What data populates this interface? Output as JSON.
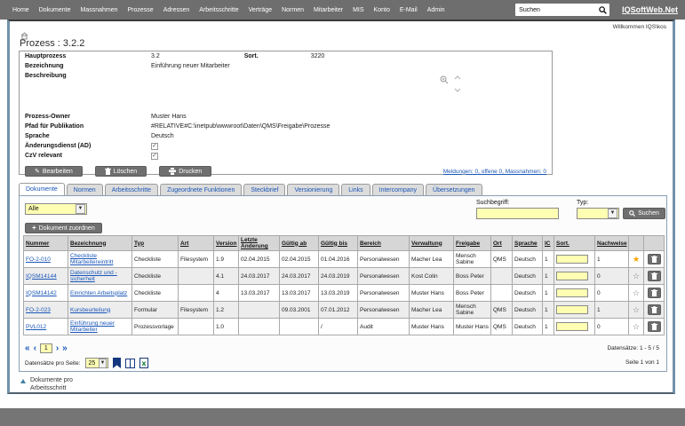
{
  "nav": {
    "items": [
      "Home",
      "Dokumente",
      "Massnahmen",
      "Prozesse",
      "Adressen",
      "Arbeitsschritte",
      "Verträge",
      "Normen",
      "Mitarbeiter",
      "MIS",
      "Konto",
      "E-Mail",
      "Admin"
    ],
    "search_value": "Suchen",
    "brand": "IQSoftWeb.Net"
  },
  "welcome": "Willkommen IQS\\kos",
  "page_title": "Prozess : 3.2.2",
  "form": {
    "hauptprozess_label": "Hauptprozess",
    "hauptprozess_value": "3.2",
    "sort_label": "Sort.",
    "sort_value": "3220",
    "bezeichnung_label": "Bezeichnung",
    "bezeichnung_value": "Einführung neuer Mitarbeiter",
    "beschreibung_label": "Beschreibung",
    "beschreibung_value": "",
    "owner_label": "Prozess-Owner",
    "owner_value": "Muster Hans",
    "pfad_label": "Pfad für Publikation",
    "pfad_value": "#RELATIVE#C:\\inetpub\\wwwroot\\Daten\\QMS\\Freigabe\\Prozesse",
    "sprache_label": "Sprache",
    "sprache_value": "Deutsch",
    "ad_label": "Änderungsdienst (AD)",
    "ad_checked": "✓",
    "czv_label": "CzV relevant",
    "czv_checked": "✓"
  },
  "actions": {
    "edit": "Bearbeiten",
    "delete": "Löschen",
    "print": "Drucken",
    "meldungen_link": "Meldungen: 0, offene 0, Massnahmen: 0"
  },
  "tabs": {
    "active_index": 0,
    "items": [
      "Dokumente",
      "Normen",
      "Arbeitsschritte",
      "Zugeordnete Funktionen",
      "Steckbrief",
      "Versionierung",
      "Links",
      "Intercompany",
      "Übersetzungen"
    ]
  },
  "filter": {
    "alle_value": "Alle",
    "suchbegriff_label": "Suchbegriff:",
    "typ_label": "Typ:",
    "typ_value": "",
    "suchen_button": "Suchen",
    "plus": "+",
    "add_button": "Dokument zuordnen"
  },
  "table": {
    "headers": [
      "Nummer",
      "Bezeichnung",
      "Typ",
      "Art",
      "Version",
      "Letzte Änderung",
      "Gültig ab",
      "Gültig bis",
      "Bereich",
      "Verwaltung",
      "Freigabe",
      "Ort",
      "Sprache",
      "IC",
      "Sort.",
      "Nachweise"
    ],
    "rows": [
      {
        "nummer": "FO-2-010",
        "bezeichnung": "Checkliste Mitarbeitereintritt",
        "typ": "Checkliste",
        "art": "Filesystem",
        "version": "1.9",
        "letzte_aenderung": "02.04.2015",
        "gueltig_ab": "02.04.2015",
        "gueltig_bis": "01.04.2016",
        "bereich": "Personalwesen",
        "verwaltung": "Macher Lea",
        "freigabe": "Mensch Sabine",
        "ort": "QMS",
        "sprache": "Deutsch",
        "ic": "1",
        "sort": "",
        "nachweise": "1",
        "starred": true
      },
      {
        "nummer": "IQSM14144",
        "bezeichnung": "Datenschutz und -sicherheit",
        "typ": "Checkliste",
        "art": "",
        "version": "4.1",
        "letzte_aenderung": "24.03.2017",
        "gueltig_ab": "24.03.2017",
        "gueltig_bis": "24.03.2019",
        "bereich": "Personalwesen",
        "verwaltung": "Kost Colin",
        "freigabe": "Boss Peter",
        "ort": "",
        "sprache": "Deutsch",
        "ic": "1",
        "sort": "",
        "nachweise": "0",
        "starred": false
      },
      {
        "nummer": "IQSM14142",
        "bezeichnung": "Einrichten Arbeitsplatz",
        "typ": "Checkliste",
        "art": "",
        "version": "4",
        "letzte_aenderung": "13.03.2017",
        "gueltig_ab": "13.03.2017",
        "gueltig_bis": "13.03.2019",
        "bereich": "Personalwesen",
        "verwaltung": "Muster Hans",
        "freigabe": "Boss Peter",
        "ort": "",
        "sprache": "Deutsch",
        "ic": "1",
        "sort": "",
        "nachweise": "0",
        "starred": false
      },
      {
        "nummer": "FO-2-023",
        "bezeichnung": "Kursbeurteilung",
        "typ": "Formular",
        "art": "Filesystem",
        "version": "1.2",
        "letzte_aenderung": "",
        "gueltig_ab": "09.03.2001",
        "gueltig_bis": "07.01.2012",
        "bereich": "Personalwesen",
        "verwaltung": "Macher Lea",
        "freigabe": "Mensch Sabine",
        "ort": "QMS",
        "sprache": "Deutsch",
        "ic": "1",
        "sort": "",
        "nachweise": "1",
        "starred": false
      },
      {
        "nummer": "PVL012",
        "bezeichnung": "Einführung neuer Mitarbeiter",
        "typ": "Prozessvorlage",
        "art": "",
        "version": "1.0",
        "letzte_aenderung": "",
        "gueltig_ab": "",
        "gueltig_bis": "/",
        "bereich": "Audit",
        "verwaltung": "Muster Hans",
        "freigabe": "Muster Hans",
        "ort": "QMS",
        "sprache": "Deutsch",
        "ic": "1",
        "sort": "",
        "nachweise": "0",
        "starred": false
      }
    ]
  },
  "pagination": {
    "first": "«",
    "prev": "‹",
    "page": "1",
    "next": "›",
    "last": "»",
    "records": "Datensätze: 1 - 5 / 5",
    "per_page_label": "Datensätze pro Seite:",
    "per_page_value": "25",
    "page_info": "Seite 1 von 1"
  },
  "bottom_section_label": "Dokumente pro Arbeitsschritt",
  "colors": {
    "nav_bg": "#6e6e6e",
    "accent_input": "#ffffb3",
    "link_blue": "#1a56b8",
    "star_orange": "#f5a300",
    "button_gray": "#6f6f6f",
    "border_blue": "#7193ab"
  }
}
